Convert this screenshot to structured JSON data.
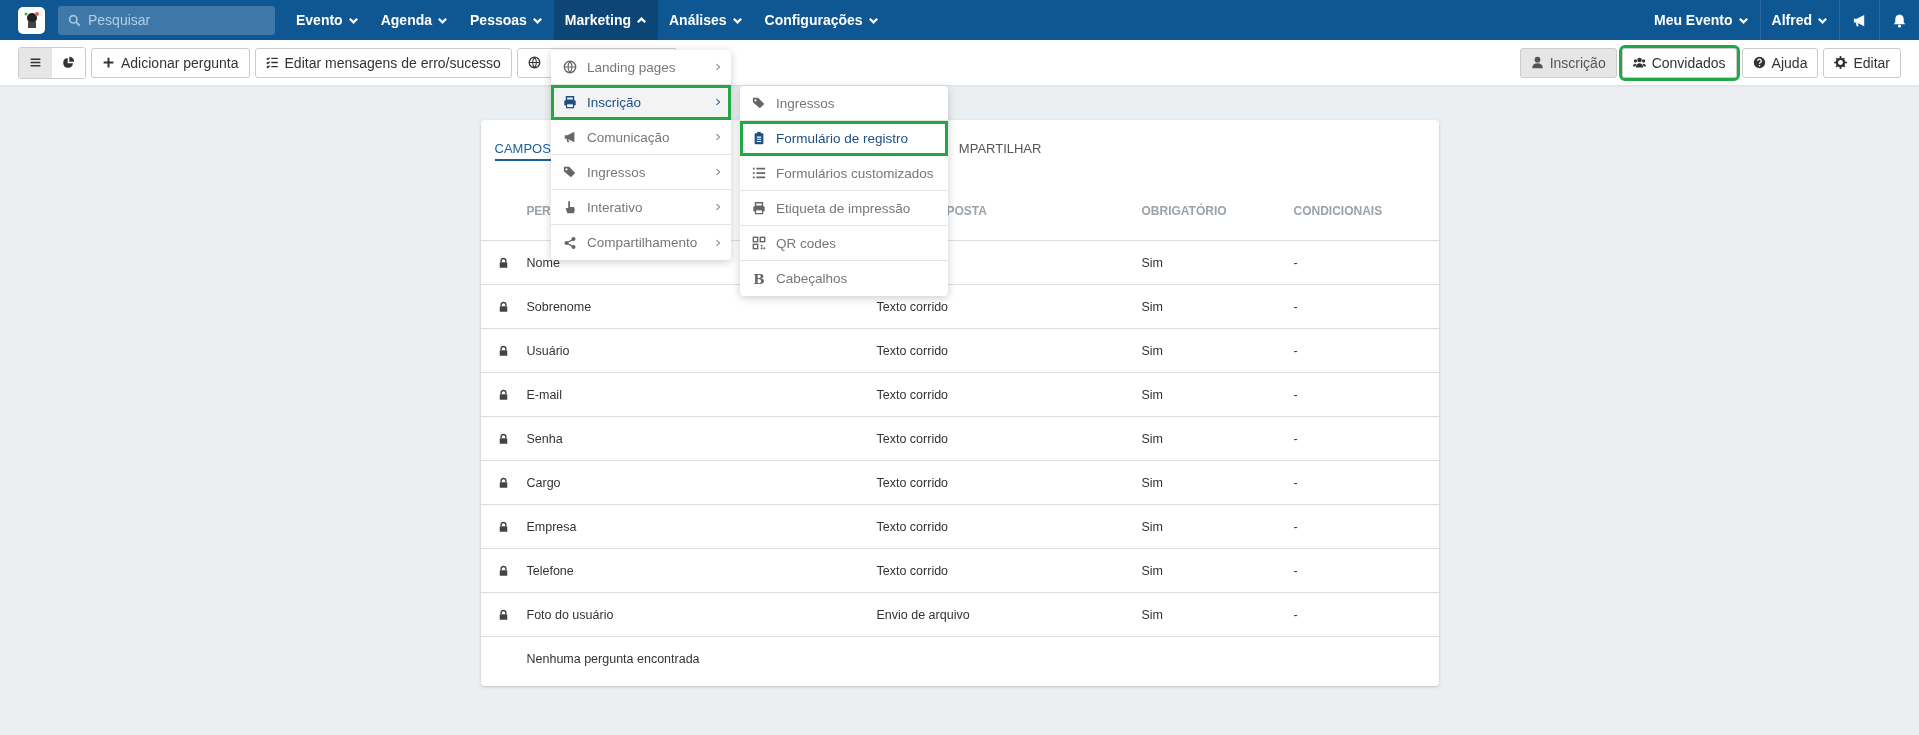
{
  "topbar": {
    "search": {
      "placeholder": "Pesquisar"
    },
    "nav": [
      {
        "label": "Evento",
        "expanded": false
      },
      {
        "label": "Agenda",
        "expanded": false
      },
      {
        "label": "Pessoas",
        "expanded": false
      },
      {
        "label": "Marketing",
        "expanded": true
      },
      {
        "label": "Análises",
        "expanded": false
      },
      {
        "label": "Configurações",
        "expanded": false
      }
    ],
    "right": [
      {
        "label": "Meu Evento",
        "kind": "dropdown"
      },
      {
        "label": "Alfred",
        "kind": "dropdown"
      },
      {
        "kind": "megaphone"
      },
      {
        "kind": "bell"
      }
    ]
  },
  "toolbar": {
    "view_toggle": [
      {
        "kind": "list",
        "selected": true
      },
      {
        "kind": "chart",
        "selected": false
      }
    ],
    "left_buttons": [
      {
        "label": "Adicionar pergunta",
        "kind": "plus"
      },
      {
        "label": "Editar mensagens de erro/sucesso",
        "kind": "checklist"
      },
      {
        "kind": "globe"
      }
    ],
    "right_buttons": [
      {
        "label": "Inscrição",
        "kind": "user",
        "selected": true,
        "highlighted": false
      },
      {
        "label": "Convidados",
        "kind": "users",
        "selected": false,
        "highlighted": true
      },
      {
        "label": "Ajuda",
        "kind": "help",
        "selected": false,
        "highlighted": false
      },
      {
        "label": "Editar",
        "kind": "gear",
        "selected": false,
        "highlighted": false
      }
    ]
  },
  "card": {
    "tabs": [
      {
        "label": "CAMPOS",
        "selected": true
      },
      {
        "label": "MPARTILHAR",
        "selected": false
      }
    ],
    "columns": [
      "PER",
      "POSTA",
      "OBRIGATÓRIO",
      "CONDICIONAIS"
    ],
    "rows": [
      {
        "kind": "field",
        "locked": true,
        "question": "Nome",
        "type": "",
        "required": "Sim",
        "conditional": "-"
      },
      {
        "kind": "field",
        "locked": true,
        "question": "Sobrenome",
        "type": "Texto corrido",
        "required": "Sim",
        "conditional": "-"
      },
      {
        "kind": "field",
        "locked": true,
        "question": "Usuário",
        "type": "Texto corrido",
        "required": "Sim",
        "conditional": "-"
      },
      {
        "kind": "field",
        "locked": true,
        "question": "E-mail",
        "type": "Texto corrido",
        "required": "Sim",
        "conditional": "-"
      },
      {
        "kind": "field",
        "locked": true,
        "question": "Senha",
        "type": "Texto corrido",
        "required": "Sim",
        "conditional": "-"
      },
      {
        "kind": "field",
        "locked": true,
        "question": "Cargo",
        "type": "Texto corrido",
        "required": "Sim",
        "conditional": "-"
      },
      {
        "kind": "field",
        "locked": true,
        "question": "Empresa",
        "type": "Texto corrido",
        "required": "Sim",
        "conditional": "-"
      },
      {
        "kind": "field",
        "locked": true,
        "question": "Telefone",
        "type": "Texto corrido",
        "required": "Sim",
        "conditional": "-"
      },
      {
        "kind": "field",
        "locked": true,
        "question": "Foto do usuário",
        "type": "Envio de arquivo",
        "required": "Sim",
        "conditional": "-"
      },
      {
        "kind": "empty",
        "question": "Nenhuma pergunta encontrada"
      }
    ]
  },
  "marketing_menu": [
    {
      "label": "Landing pages",
      "kind": "globe",
      "selected": false,
      "highlighted": false
    },
    {
      "label": "Inscrição",
      "kind": "printer",
      "selected": true,
      "highlighted": true
    },
    {
      "label": "Comunicação",
      "kind": "megaphone",
      "selected": false,
      "highlighted": false
    },
    {
      "label": "Ingressos",
      "kind": "tags",
      "selected": false,
      "highlighted": false
    },
    {
      "label": "Interativo",
      "kind": "hand",
      "selected": false,
      "highlighted": false
    },
    {
      "label": "Compartilhamento",
      "kind": "share",
      "selected": false,
      "highlighted": false
    }
  ],
  "inscricao_submenu": [
    {
      "label": "Ingressos",
      "kind": "tag",
      "selected": false,
      "highlighted": false
    },
    {
      "label": "Formulário de registro",
      "kind": "clipboard",
      "selected": true,
      "highlighted": true
    },
    {
      "label": "Formulários customizados",
      "kind": "list",
      "selected": false,
      "highlighted": false
    },
    {
      "label": "Etiqueta de impressão",
      "kind": "printer",
      "selected": false,
      "highlighted": false
    },
    {
      "label": "QR codes",
      "kind": "qr",
      "selected": false,
      "highlighted": false
    },
    {
      "label": "Cabeçalhos",
      "kind": "glyph",
      "glyph": "B",
      "selected": false,
      "highlighted": false
    }
  ]
}
